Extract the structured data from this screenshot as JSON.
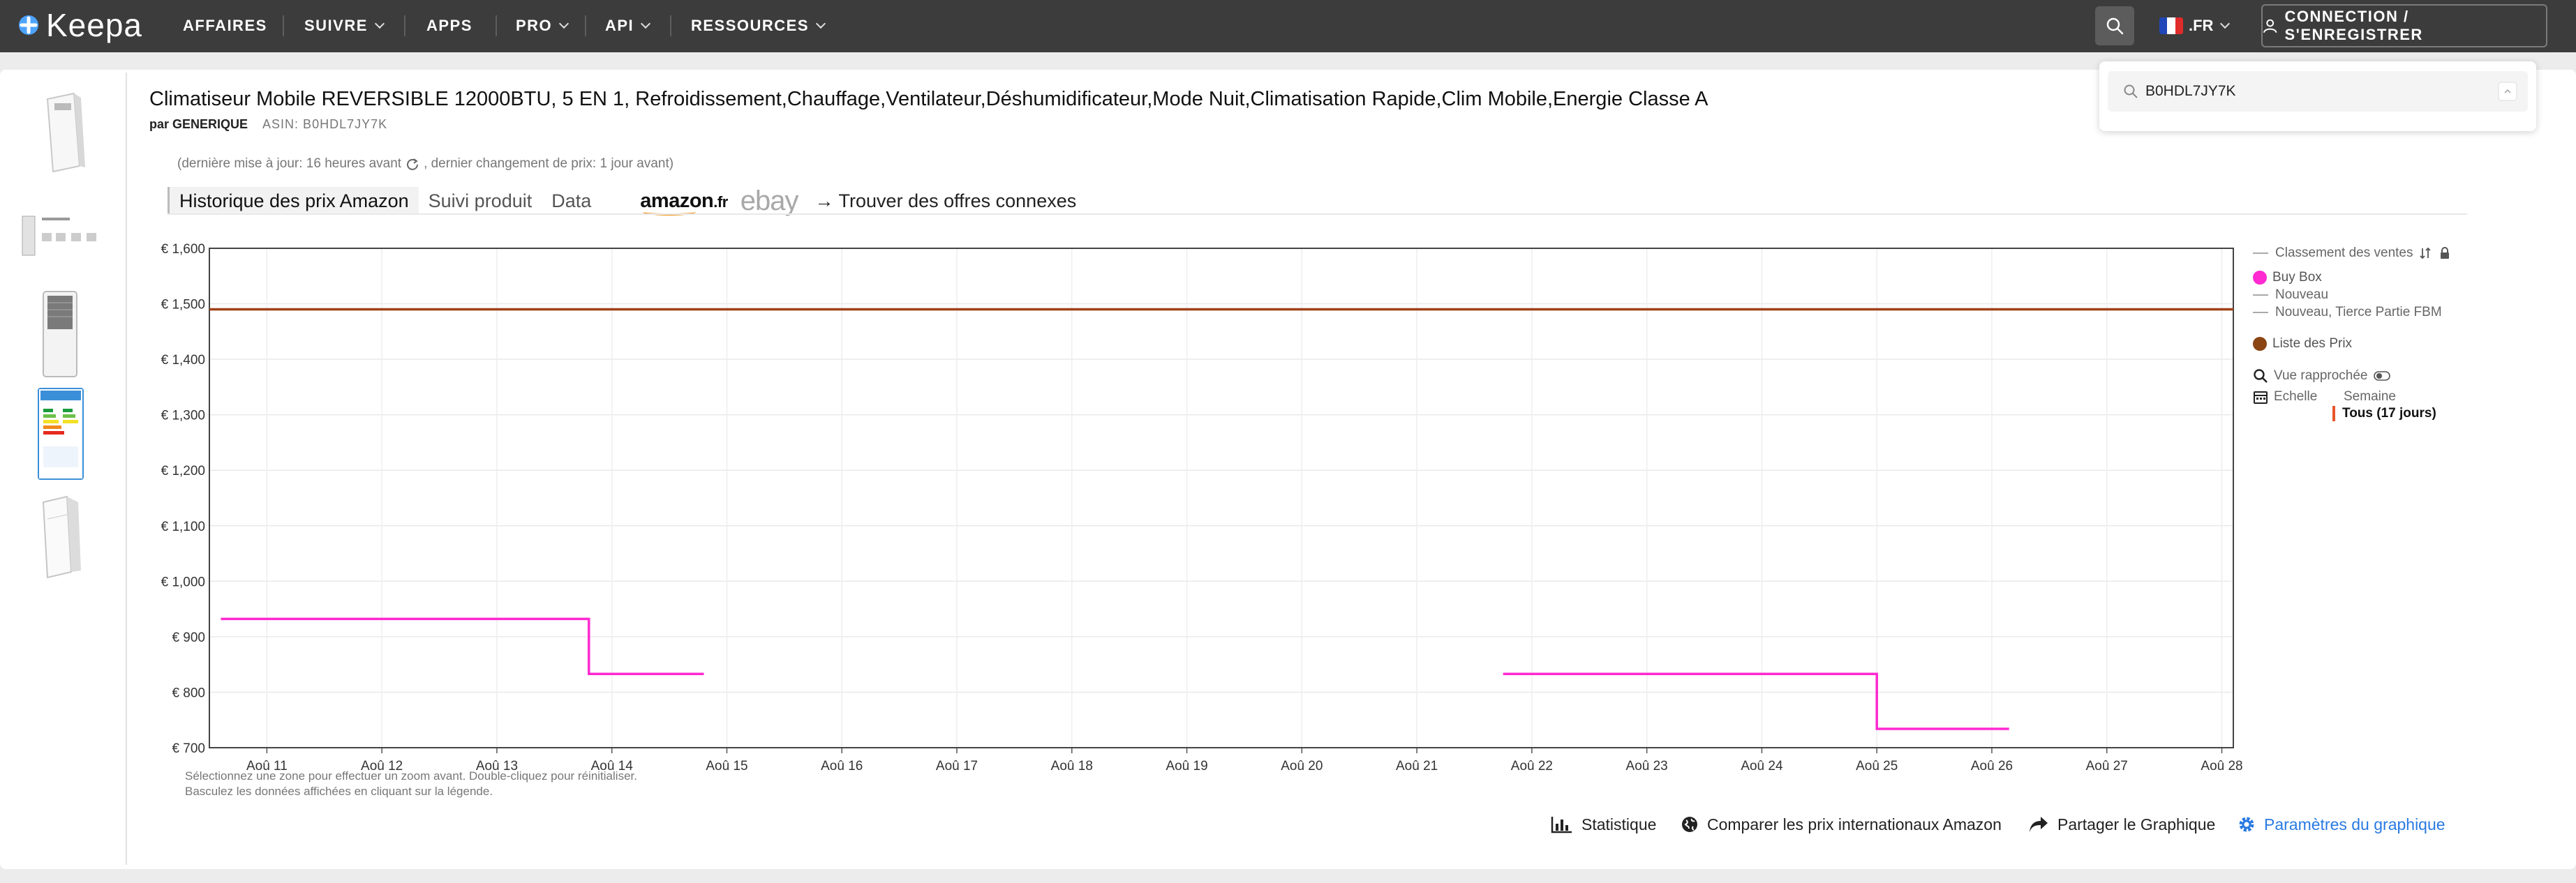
{
  "nav": {
    "logo": "Keepa",
    "items": [
      {
        "label": "AFFAIRES",
        "dropdown": false
      },
      {
        "label": "SUIVRE",
        "dropdown": true
      },
      {
        "label": "APPS",
        "dropdown": false
      },
      {
        "label": "PRO",
        "dropdown": true
      },
      {
        "label": "API",
        "dropdown": true
      },
      {
        "label": "RESSOURCES",
        "dropdown": true
      }
    ],
    "language": ".FR",
    "connect_label": "CONNECTION / S'ENREGISTRER",
    "search_value": "B0HDL7JY7K"
  },
  "product": {
    "title": "Climatiseur Mobile REVERSIBLE 12000BTU, 5 EN 1, Refroidissement,Chauffage,Ventilateur,Déshumidificateur,Mode Nuit,Climatisation Rapide,Clim Mobile,Energie Classe A",
    "by": "par GENERIQUE",
    "asin": "ASIN: B0HDL7JY7K",
    "updated_prefix": "(dernière mise à jour: 16 heures avant",
    "updated_suffix": ",  dernier changement de prix: 1 jour avant)"
  },
  "tabs": [
    "Historique des prix Amazon",
    "Suivi produit",
    "Data"
  ],
  "logos": {
    "amazon": "amazon",
    "amazon_tld": ".fr",
    "ebay": "ebay"
  },
  "find_offers": "→ Trouver des offres connexes",
  "chart_data": {
    "type": "line",
    "x_ticks": [
      "Aoû 11",
      "Aoû 12",
      "Aoû 13",
      "Aoû 14",
      "Aoû 15",
      "Aoû 16",
      "Aoû 17",
      "Aoû 18",
      "Aoû 19",
      "Aoû 20",
      "Aoû 21",
      "Aoû 22",
      "Aoû 23",
      "Aoû 24",
      "Aoû 25",
      "Aoû 26",
      "Aoû 27",
      "Aoû 28"
    ],
    "y_ticks": [
      "€ 700",
      "€ 800",
      "€ 900",
      "€ 1,000",
      "€ 1,100",
      "€ 1,200",
      "€ 1,300",
      "€ 1,400",
      "€ 1,500",
      "€ 1,600"
    ],
    "x_range_days": [
      10.5,
      28.1
    ],
    "ylim": [
      700,
      1600
    ],
    "series": [
      {
        "name": "Liste des Prix",
        "color": "#a0401a",
        "segments": [
          [
            [
              10.5,
              1490
            ],
            [
              28.1,
              1490
            ]
          ]
        ]
      },
      {
        "name": "Buy Box",
        "color": "#ff2ad0",
        "segments": [
          [
            [
              10.6,
              932
            ],
            [
              13.8,
              932
            ],
            [
              13.8,
              833
            ],
            [
              14.8,
              833
            ]
          ],
          [
            [
              21.75,
              833
            ],
            [
              25.0,
              833
            ],
            [
              25.0,
              734
            ],
            [
              26.15,
              734
            ]
          ]
        ]
      }
    ]
  },
  "hint_lines": [
    "Sélectionnez une zone pour effectuer un zoom avant. Double-cliquez pour réinitialiser.",
    "Basculez les données affichées en cliquant sur la légende."
  ],
  "legend": {
    "sales_rank": "Classement des ventes",
    "buy_box": "Buy Box",
    "new": "Nouveau",
    "new_fbm": "Nouveau, Tierce Partie FBM",
    "list_price": "Liste des Prix",
    "zoom": "Vue rapprochée",
    "scale": "Echelle",
    "week": "Semaine",
    "all": "Tous (17 jours)",
    "colors": {
      "buy_box": "#ff2ad0",
      "list_price": "#8b4513",
      "accent": "#e8562a"
    }
  },
  "bottom_links": {
    "stats": "Statistique",
    "compare": "Comparer les prix internationaux Amazon",
    "share": "Partager le Graphique",
    "settings": "Paramètres du graphique"
  }
}
